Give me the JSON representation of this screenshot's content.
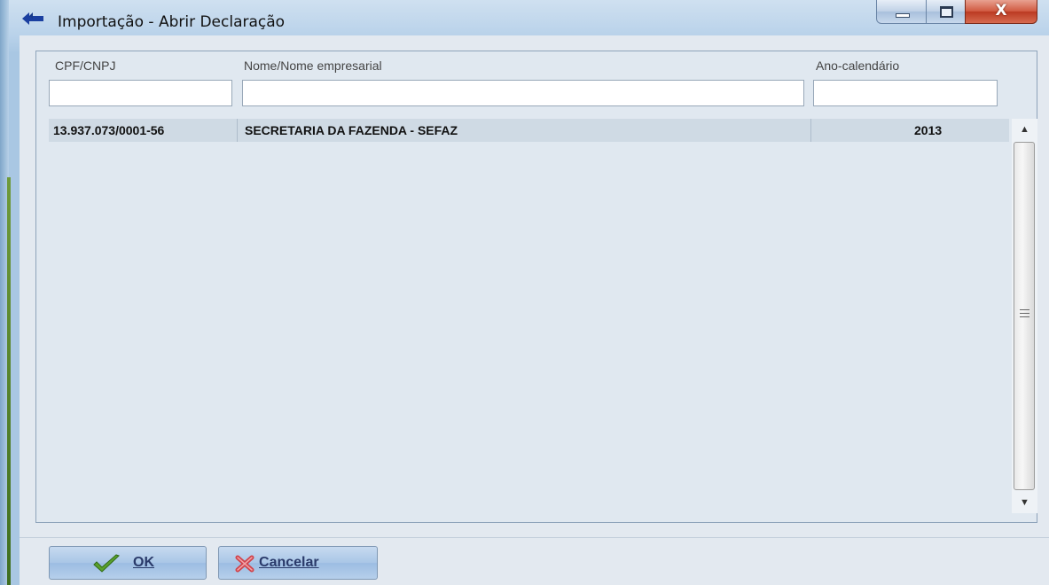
{
  "window": {
    "title": "Importação - Abrir Declaração",
    "controls": {
      "minimize": "minimize-button",
      "maximize": "maximize-button",
      "close": "close-button",
      "close_glyph": "X"
    }
  },
  "filters": {
    "cpf_label": "CPF/CNPJ",
    "nome_label": "Nome/Nome empresarial",
    "ano_label": "Ano-calendário",
    "cpf_value": "",
    "nome_value": "",
    "ano_value": ""
  },
  "rows": [
    {
      "cnpj": "13.937.073/0001-56",
      "nome": "SECRETARIA DA FAZENDA - SEFAZ",
      "ano": "2013"
    }
  ],
  "buttons": {
    "ok_accel": "O",
    "ok_rest": "K",
    "cancel_accel": "C",
    "cancel_rest": "ancelar"
  },
  "colors": {
    "accent": "#a9c7e3",
    "selection_row": "#cfdae4",
    "close_button": "#d0583f",
    "ok_check": "#5aa02c",
    "cancel_x": "#d0434b"
  },
  "icons": {
    "app": "arrow-icon",
    "ok": "checkmark-icon",
    "cancel": "x-icon",
    "scroll_up": "scroll-up-icon",
    "scroll_down": "scroll-down-icon"
  }
}
